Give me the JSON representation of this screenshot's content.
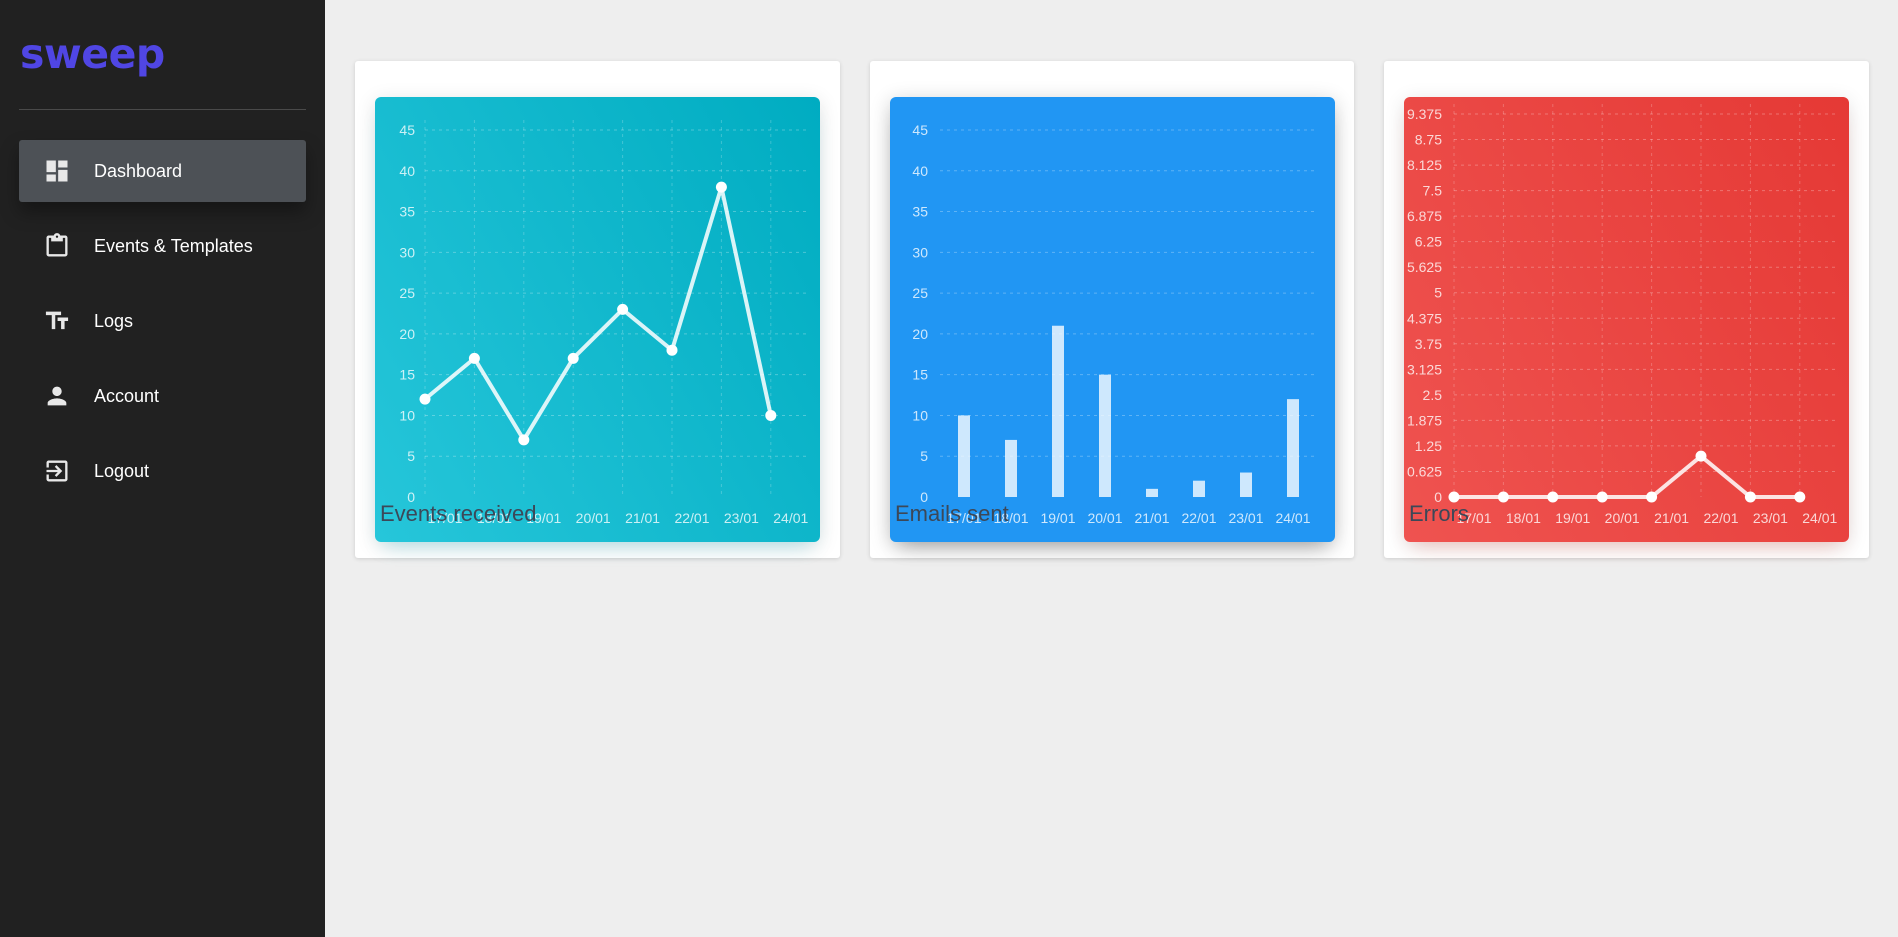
{
  "app": {
    "logo_text": "sweep",
    "accent_color": "#5046e4"
  },
  "sidebar": {
    "items": [
      {
        "label": "Dashboard",
        "icon": "dashboard-icon",
        "active": true
      },
      {
        "label": "Events & Templates",
        "icon": "clipboard-icon",
        "active": false
      },
      {
        "label": "Logs",
        "icon": "text-style-icon",
        "active": false
      },
      {
        "label": "Account",
        "icon": "person-icon",
        "active": false
      },
      {
        "label": "Logout",
        "icon": "logout-icon",
        "active": false
      }
    ]
  },
  "cards": [
    {
      "title": "Events received",
      "color": "#00bcd4"
    },
    {
      "title": "Emails sent",
      "color": "#2196f3"
    },
    {
      "title": "Errors",
      "color": "#f44336"
    }
  ],
  "chart_data": [
    {
      "type": "line",
      "categories": [
        "17/01",
        "18/01",
        "19/01",
        "20/01",
        "21/01",
        "22/01",
        "23/01",
        "24/01"
      ],
      "values": [
        12,
        17,
        7,
        17,
        23,
        18,
        38,
        10
      ],
      "yticks": [
        "0",
        "5",
        "10",
        "15",
        "20",
        "25",
        "30",
        "35",
        "40",
        "45"
      ],
      "ylim": [
        0,
        45
      ],
      "grid": true
    },
    {
      "type": "bar",
      "categories": [
        "17/01",
        "18/01",
        "19/01",
        "20/01",
        "21/01",
        "22/01",
        "23/01",
        "24/01"
      ],
      "values": [
        10,
        7,
        21,
        15,
        1,
        2,
        3,
        12
      ],
      "yticks": [
        "0",
        "5",
        "10",
        "15",
        "20",
        "25",
        "30",
        "35",
        "40",
        "45"
      ],
      "ylim": [
        0,
        45
      ],
      "grid": true
    },
    {
      "type": "line",
      "categories": [
        "17/01",
        "18/01",
        "19/01",
        "20/01",
        "21/01",
        "22/01",
        "23/01",
        "24/01"
      ],
      "values": [
        0,
        0,
        0,
        0,
        0,
        1,
        0,
        0
      ],
      "yticks": [
        "0",
        "0.625",
        "1.25",
        "1.875",
        "2.5",
        "3.125",
        "3.75",
        "4.375",
        "5",
        "5.625",
        "6.25",
        "6.875",
        "7.5",
        "8.125",
        "8.75",
        "9.375"
      ],
      "ylim": [
        0,
        9.375
      ],
      "grid": true
    }
  ]
}
